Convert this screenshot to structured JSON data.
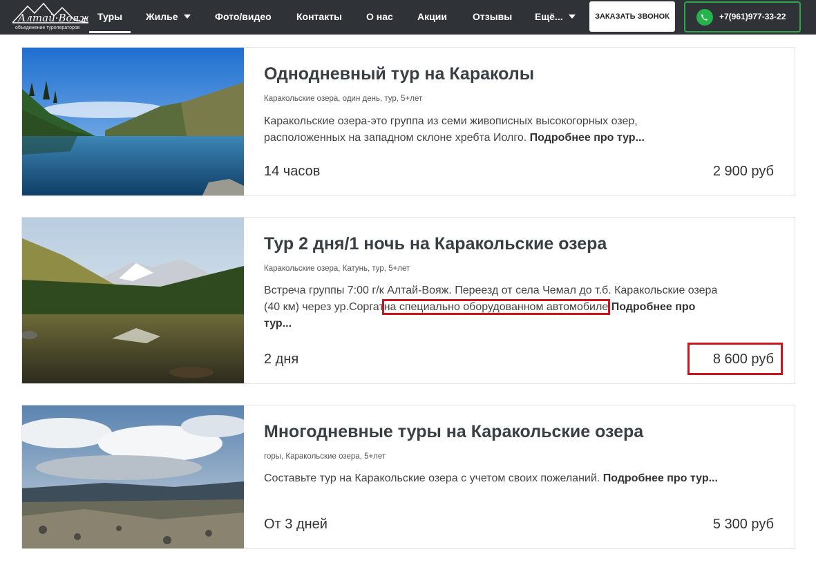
{
  "nav": {
    "logo_text": "объединение туроператоров",
    "items": [
      {
        "label": "Туры",
        "active": true
      },
      {
        "label": "Жилье",
        "dropdown": true
      },
      {
        "label": "Фото/видео"
      },
      {
        "label": "Контакты"
      },
      {
        "label": "О нас"
      },
      {
        "label": "Акции"
      },
      {
        "label": "Отзывы"
      },
      {
        "label": "Ещё...",
        "dropdown": true
      }
    ],
    "call_button": "ЗАКАЗАТЬ ЗВОНОК",
    "phone": "+7(961)977-33-22",
    "phone_icon": "whatsapp-icon"
  },
  "cards": [
    {
      "title": "Однодневный тур на Караколы",
      "tags": "Каракольские озера, один день, тур, 5+лет",
      "desc_lines": [
        "Каракольские озера-это группа из семи живописных высокогорных озер,",
        "расположенных на западном склоне хребта Иолго."
      ],
      "more": "Подробнее про тур...",
      "duration": "14 часов",
      "price": "2 900 руб"
    },
    {
      "title": "Тур 2 дня/1 ночь на Каракольские озера",
      "tags": "Каракольские озера, Катунь, тур, 5+лет",
      "desc_line1": "Встреча группы 7:00 г/к Алтай-Вояж. Переезд от села Чемал до т.б. Каракольские озера",
      "desc_line2_a": "(40 км) через ур.Соргат",
      "desc_line2_hl": "на специально оборудованном автомобиле",
      "more_a": "Подробнее про",
      "more_b": "тур...",
      "duration": "2 дня",
      "price": "8 600 руб"
    },
    {
      "title": "Многодневные туры на Каракольские озера",
      "tags": "горы, Каракольские озера, 5+лет",
      "desc": "Составьте тур на Каракольские озера с учетом своих пожеланий.",
      "more": "Подробнее про тур...",
      "duration": "От 3 дней",
      "price": "5 300 руб"
    }
  ]
}
